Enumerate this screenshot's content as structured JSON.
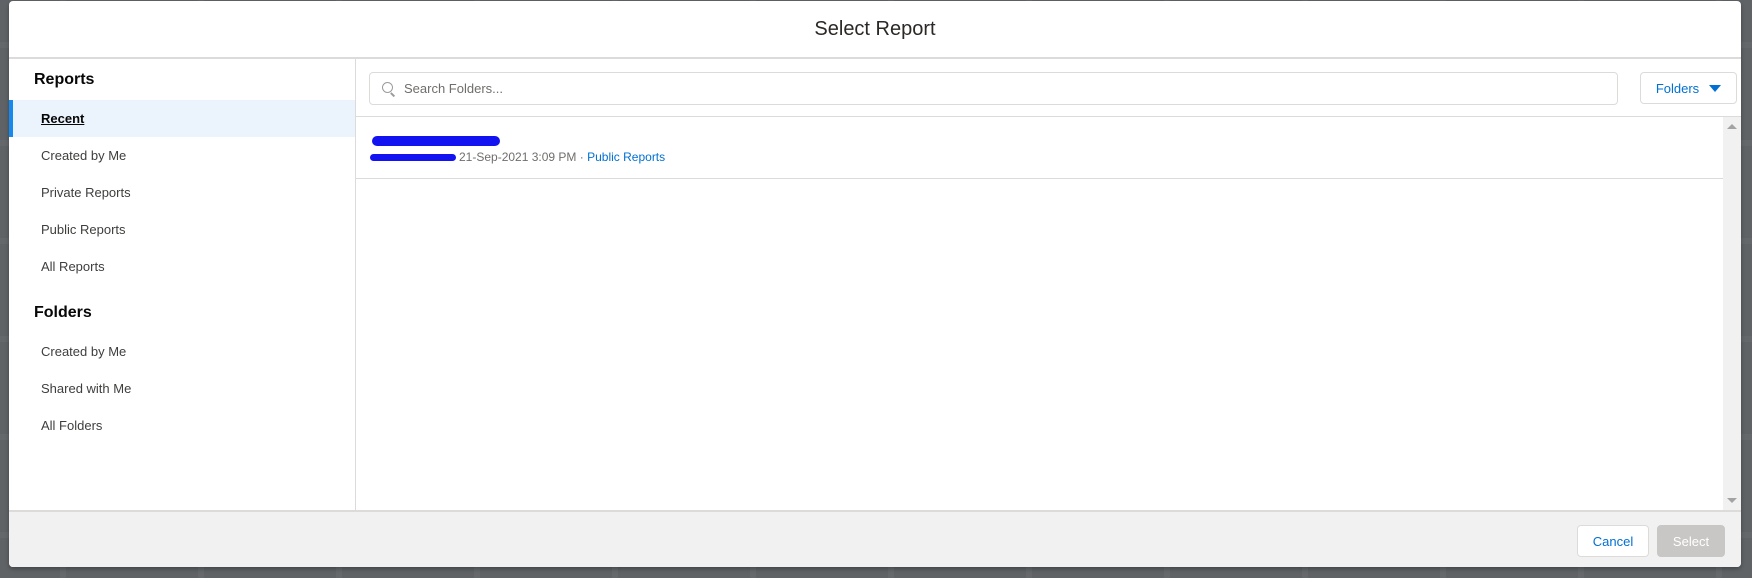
{
  "dialog": {
    "title": "Select Report"
  },
  "sidebar": {
    "reports_section": {
      "title": "Reports",
      "items": [
        {
          "label": "Recent",
          "active": true
        },
        {
          "label": "Created by Me",
          "active": false
        },
        {
          "label": "Private Reports",
          "active": false
        },
        {
          "label": "Public Reports",
          "active": false
        },
        {
          "label": "All Reports",
          "active": false
        }
      ]
    },
    "folders_section": {
      "title": "Folders",
      "items": [
        {
          "label": "Created by Me"
        },
        {
          "label": "Shared with Me"
        },
        {
          "label": "All Folders"
        }
      ]
    }
  },
  "toolbar": {
    "search": {
      "placeholder": "Search Folders...",
      "value": ""
    },
    "folders_dropdown": {
      "label": "Folders",
      "icon": "caret-down-icon"
    }
  },
  "results": [
    {
      "name": "[redacted]",
      "owner": "[redacted]",
      "timestamp": "21-Sep-2021 3:09 PM",
      "separator": "·",
      "folder": "Public Reports"
    }
  ],
  "footer": {
    "cancel_label": "Cancel",
    "select_label": "Select"
  },
  "colors": {
    "accent": "#0070d2",
    "active_indicator": "#1589ee",
    "active_bg": "#ebf3fd",
    "disabled_button": "#c9c7c5",
    "redaction": "#1313f2"
  }
}
